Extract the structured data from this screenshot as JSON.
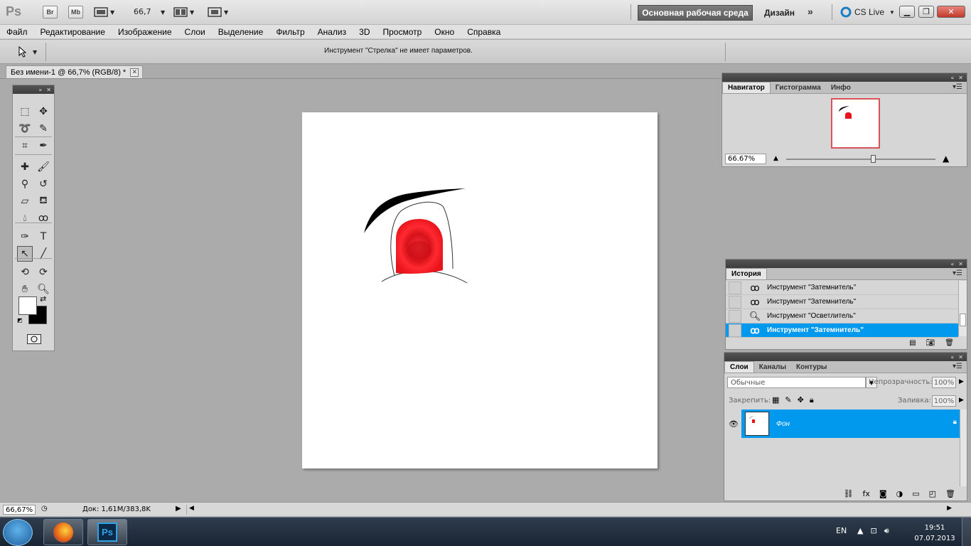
{
  "appbar": {
    "logo": "Ps",
    "br_label": "Br",
    "mb_label": "Mb",
    "zoom_value": "66,7",
    "workspace_label": "Основная рабочая среда",
    "design_label": "Дизайн",
    "more_label": "»",
    "cslive_label": "CS Live",
    "minimize_icon": "minimize-icon",
    "restore_icon": "restore-icon",
    "close_icon": "close-icon"
  },
  "menu": [
    "Файл",
    "Редактирование",
    "Изображение",
    "Слои",
    "Выделение",
    "Фильтр",
    "Анализ",
    "3D",
    "Просмотр",
    "Окно",
    "Справка"
  ],
  "options": {
    "tool_icon": "arrow-tool-icon",
    "message": "Инструмент \"Стрелка\" не имеет параметров."
  },
  "document": {
    "tab_title": "Без имени-1 @ 66,7% (RGB/8) *",
    "canvas_color": "#ffffff",
    "pupil_color": "#ee1c25"
  },
  "toolbox": {
    "tools": [
      [
        "marquee-icon",
        "move-icon"
      ],
      [
        "lasso-icon",
        "quick-selection-icon"
      ],
      [
        "crop-icon",
        "eyedropper-icon"
      ],
      [
        "healing-brush-icon",
        "brush-icon"
      ],
      [
        "clone-stamp-icon",
        "history-brush-icon"
      ],
      [
        "eraser-icon",
        "paint-bucket-icon"
      ],
      [
        "blur-icon",
        "dodge-burn-icon"
      ],
      [
        "pen-icon",
        "type-icon"
      ],
      [
        "path-selection-icon",
        "line-icon"
      ],
      [
        "3d-rotate-icon",
        "3d-orbit-icon"
      ],
      [
        "hand-icon",
        "zoom-icon"
      ]
    ],
    "foreground": "#ffffff",
    "background": "#000000"
  },
  "status": {
    "zoom": "66,67%",
    "doc": "Док: 1,61M/383,8K"
  },
  "navigator": {
    "tabs": [
      "Навигатор",
      "Гистограмма",
      "Инфо"
    ],
    "zoom": "66.67%",
    "zoom_level": 0.58
  },
  "history": {
    "tab": "История",
    "items": [
      {
        "label": "Инструмент \"Затемнитель\"",
        "icon": "burn-tool-icon"
      },
      {
        "label": "Инструмент \"Затемнитель\"",
        "icon": "burn-tool-icon"
      },
      {
        "label": "Инструмент \"Осветлитель\"",
        "icon": "dodge-tool-icon"
      },
      {
        "label": "Инструмент \"Затемнитель\"",
        "icon": "burn-tool-icon"
      }
    ]
  },
  "layers": {
    "tabs": [
      "Слои",
      "Каналы",
      "Контуры"
    ],
    "blend_mode": "Обычные",
    "opacity_label": "Непрозрачность:",
    "opacity": "100%",
    "lock_label": "Закрепить:",
    "fill_label": "Заливка:",
    "fill": "100%",
    "layer_name": "Фон"
  },
  "taskbar": {
    "lang": "EN",
    "time": "19:51",
    "date": "07.07.2013",
    "ps_label": "Ps"
  }
}
